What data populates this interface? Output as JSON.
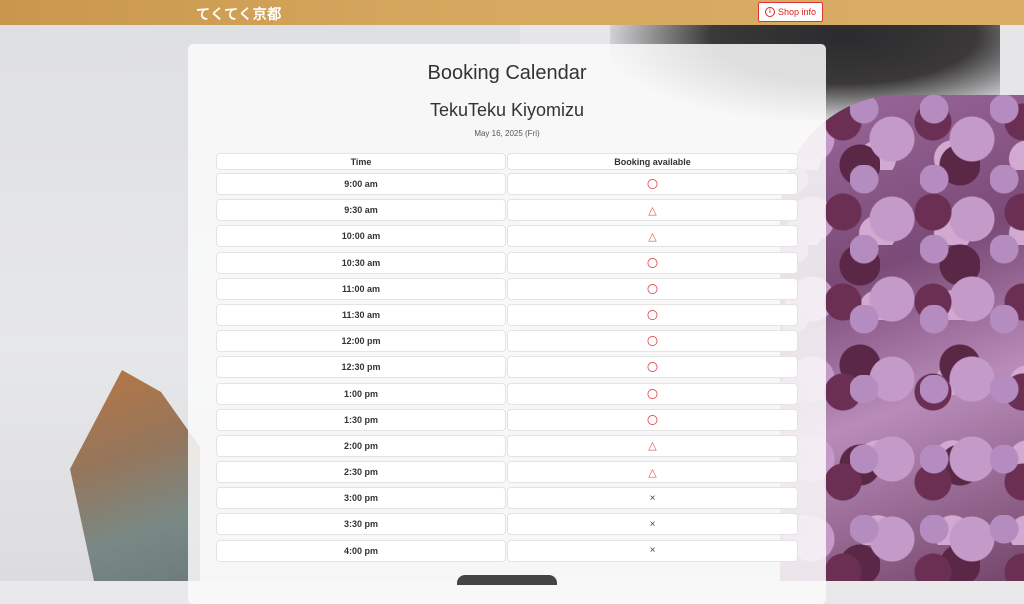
{
  "header": {
    "brand": "てくてく京都",
    "shop_info_label": "Shop info"
  },
  "calendar": {
    "title": "Booking Calendar",
    "shop_name": "TekuTeku Kiyomizu",
    "date": "May 16, 2025 (Fri)",
    "columns": [
      "Time",
      "Booking available"
    ],
    "rows": [
      {
        "time": "9:00 am",
        "status": "〇"
      },
      {
        "time": "9:30 am",
        "status": "△"
      },
      {
        "time": "10:00 am",
        "status": "△"
      },
      {
        "time": "10:30 am",
        "status": "〇"
      },
      {
        "time": "11:00 am",
        "status": "〇"
      },
      {
        "time": "11:30 am",
        "status": "〇"
      },
      {
        "time": "12:00 pm",
        "status": "〇"
      },
      {
        "time": "12:30 pm",
        "status": "〇"
      },
      {
        "time": "1:00 pm",
        "status": "〇"
      },
      {
        "time": "1:30 pm",
        "status": "〇"
      },
      {
        "time": "2:00 pm",
        "status": "△"
      },
      {
        "time": "2:30 pm",
        "status": "△"
      },
      {
        "time": "3:00 pm",
        "status": "×"
      },
      {
        "time": "3:30 pm",
        "status": "×"
      },
      {
        "time": "4:00 pm",
        "status": "×"
      }
    ]
  },
  "colors": {
    "header": "#d2a25a",
    "accent": "#e05050"
  }
}
